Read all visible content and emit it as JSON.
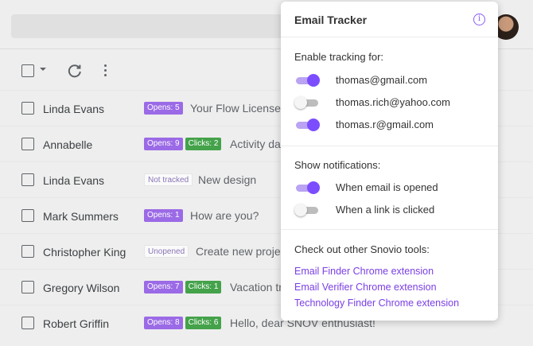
{
  "inbox": {
    "rows": [
      {
        "sender": "Linda Evans",
        "badges": [
          {
            "type": "opens",
            "text": "Opens: 5"
          }
        ],
        "subject": "Your Flow License"
      },
      {
        "sender": "Annabelle",
        "badges": [
          {
            "type": "opens",
            "text": "Opens: 9"
          },
          {
            "type": "clicks",
            "text": "Clicks: 2"
          }
        ],
        "subject": "Activity das"
      },
      {
        "sender": "Linda Evans",
        "badges": [
          {
            "type": "plain",
            "text": "Not tracked"
          }
        ],
        "subject": "New design"
      },
      {
        "sender": "Mark Summers",
        "badges": [
          {
            "type": "opens",
            "text": "Opens: 1"
          }
        ],
        "subject": "How are you?"
      },
      {
        "sender": "Christopher King",
        "badges": [
          {
            "type": "plain",
            "text": "Unopened"
          }
        ],
        "subject": "Create new projec"
      },
      {
        "sender": "Gregory Wilson",
        "badges": [
          {
            "type": "opens",
            "text": "Opens: 7"
          },
          {
            "type": "clicks",
            "text": "Clicks: 1"
          }
        ],
        "subject": "Vacation tr"
      },
      {
        "sender": "Robert Griffin",
        "badges": [
          {
            "type": "opens",
            "text": "Opens: 8"
          },
          {
            "type": "clicks",
            "text": "Clicks: 6"
          }
        ],
        "subject": "Hello, dear SNOV enthusiast!"
      }
    ]
  },
  "panel": {
    "title": "Email Tracker",
    "tracking": {
      "heading": "Enable tracking for:",
      "accounts": [
        {
          "label": "thomas@gmail.com",
          "on": true
        },
        {
          "label": "thomas.rich@yahoo.com",
          "on": false
        },
        {
          "label": "thomas.r@gmail.com",
          "on": true
        }
      ]
    },
    "notifications": {
      "heading": "Show notifications:",
      "items": [
        {
          "label": "When email is opened",
          "on": true
        },
        {
          "label": "When a link is clicked",
          "on": false
        }
      ]
    },
    "tools": {
      "heading": "Check out other Snovio tools:",
      "links": [
        "Email Finder Chrome extension",
        "Email Verifier Chrome extension",
        "Technology Finder Chrome extension"
      ]
    }
  },
  "colors": {
    "accent": "#7c4dff",
    "opens_badge": "#9b6ae6",
    "clicks_badge": "#44a24a",
    "link": "#7b3fe4"
  }
}
